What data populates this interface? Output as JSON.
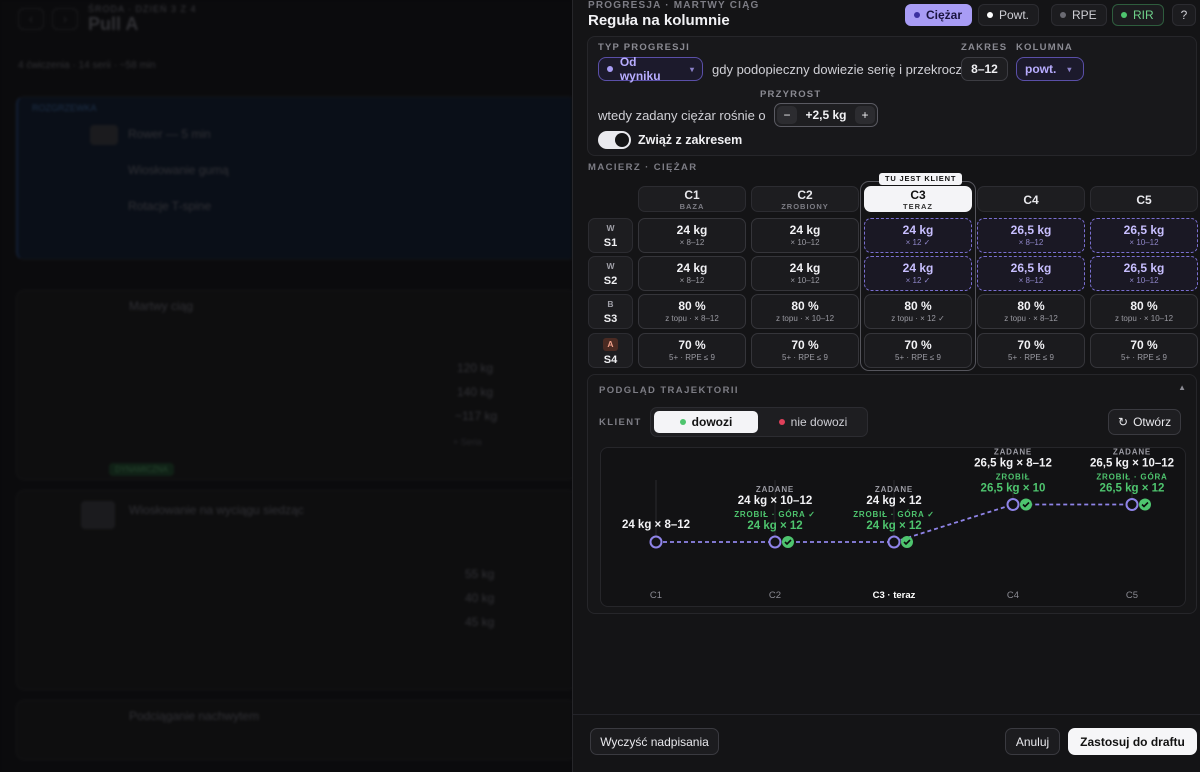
{
  "background": {
    "crumb": "ŚRODA · DZIEŃ 3 Z 4",
    "title": "Pull A",
    "meta": "4 ćwiczenia · 14 serii · ~58 min",
    "warmup_label": "ROZGRZEWKA",
    "warmup_items": [
      "Rower — 5 min",
      "Wiosłowanie gumą",
      "Rotacje T-spine"
    ],
    "exercise1": "Martwy ciąg",
    "exercise1_values": [
      "120 kg",
      "140 kg",
      "~117 kg"
    ],
    "exercise2": "Wiosłowanie na wyciągu siedząc",
    "exercise2_values": [
      "55 kg",
      "40 kg",
      "45 kg"
    ],
    "exercise3": "Podciąganie nachwytem",
    "add_set": "+ Seria",
    "progression_tag": "DYNAMICZNA"
  },
  "header": {
    "eyebrow": "PROGRESJA · MARTWY CIĄG",
    "title": "Reguła na kolumnie",
    "modes": [
      {
        "label": "Ciężar",
        "color": "#3a2fa0"
      },
      {
        "label": "Powt.",
        "color": "#ffffff"
      },
      {
        "label": "RPE",
        "color": "#6a6a72"
      },
      {
        "label": "RIR",
        "color": "#4ec46e"
      }
    ],
    "help": "?"
  },
  "rule": {
    "type_label": "TYP PROGRESJI",
    "type_value": "Od wyniku",
    "condition_text": "gdy podopieczny dowiezie serię i przekroczy",
    "range_label": "ZAKRES",
    "range_value": "8–12",
    "column_label": "KOLUMNA",
    "column_value": "powt.",
    "then_text": "wtedy zadany ciężar rośnie o",
    "increment_label": "PRZYROST",
    "increment_value": "+2,5 kg",
    "minus": "−",
    "plus": "+",
    "toggle_label": "Zwiąż z zakresem",
    "toggle_on": true
  },
  "matrix": {
    "title": "MACIERZ · CIĘŻAR",
    "current_tag": "TU JEST KLIENT",
    "columns": [
      {
        "name": "C1",
        "sub": "BAZA"
      },
      {
        "name": "C2",
        "sub": "ZROBIONY"
      },
      {
        "name": "C3",
        "sub": "TERAZ"
      },
      {
        "name": "C4",
        "sub": ""
      },
      {
        "name": "C5",
        "sub": ""
      }
    ],
    "rows": [
      {
        "tag": "W",
        "name": "S1",
        "cells": [
          {
            "v": "24 kg",
            "s": "× 8–12"
          },
          {
            "v": "24 kg",
            "s": "× 10–12"
          },
          {
            "v": "24 kg",
            "s": "× 12 ✓"
          },
          {
            "v": "26,5 kg",
            "s": "× 8–12"
          },
          {
            "v": "26,5 kg",
            "s": "× 10–12"
          }
        ]
      },
      {
        "tag": "W",
        "name": "S2",
        "cells": [
          {
            "v": "24 kg",
            "s": "× 8–12"
          },
          {
            "v": "24 kg",
            "s": "× 10–12"
          },
          {
            "v": "24 kg",
            "s": "× 12 ✓"
          },
          {
            "v": "26,5 kg",
            "s": "× 8–12"
          },
          {
            "v": "26,5 kg",
            "s": "× 10–12"
          }
        ]
      },
      {
        "tag": "B",
        "name": "S3",
        "cells": [
          {
            "v": "80 %",
            "s": "z topu · × 8–12"
          },
          {
            "v": "80 %",
            "s": "z topu · × 10–12"
          },
          {
            "v": "80 %",
            "s": "z topu · × 12 ✓"
          },
          {
            "v": "80 %",
            "s": "z topu · × 8–12"
          },
          {
            "v": "80 %",
            "s": "z topu · × 10–12"
          }
        ]
      },
      {
        "tag": "A",
        "name": "S4",
        "cells": [
          {
            "v": "70 %",
            "s": "5+ · RPE ≤ 9"
          },
          {
            "v": "70 %",
            "s": "5+ · RPE ≤ 9"
          },
          {
            "v": "70 %",
            "s": "5+ · RPE ≤ 9"
          },
          {
            "v": "70 %",
            "s": "5+ · RPE ≤ 9"
          },
          {
            "v": "70 %",
            "s": "5+ · RPE ≤ 9"
          }
        ]
      }
    ]
  },
  "trajectory": {
    "title": "PODGLĄD TRAJEKTORII",
    "client_label": "KLIENT",
    "opt_yes": "dowozi",
    "opt_no": "nie dowozi",
    "reopen": "Otwórz",
    "points": [
      {
        "x": "C1",
        "label_top": "",
        "planned": "24 kg × 8–12",
        "did_label": "",
        "did": ""
      },
      {
        "x": "C2",
        "label_top": "ZADANE",
        "planned": "24 kg × 10–12",
        "did_label": "ZROBIŁ · GÓRA ✓",
        "did": "24 kg × 12"
      },
      {
        "x": "C3 · teraz",
        "label_top": "ZADANE",
        "planned": "24 kg × 12",
        "did_label": "ZROBIŁ · GÓRA ✓",
        "did": "24 kg × 12"
      },
      {
        "x": "C4",
        "label_top": "ZADANE",
        "planned": "26,5 kg × 8–12",
        "did_label": "ZROBIŁ",
        "did": "26,5 kg × 10"
      },
      {
        "x": "C5",
        "label_top": "ZADANE",
        "planned": "26,5 kg × 10–12",
        "did_label": "ZROBIŁ · GÓRA",
        "did": "26,5 kg × 12"
      }
    ],
    "chart_data": {
      "type": "line",
      "categories": [
        "C1",
        "C2",
        "C3 · teraz",
        "C4",
        "C5"
      ],
      "series": [
        {
          "values": [
            24,
            24,
            24,
            26.5,
            26.5
          ]
        }
      ],
      "completed": [
        false,
        true,
        true,
        true,
        true
      ],
      "colors": {
        "line": "#8f84e8",
        "done": "#4ec46e"
      }
    }
  },
  "footer": {
    "clear": "Wyczyść nadpisania",
    "cancel": "Anuluj",
    "apply": "Zastosuj do draftu"
  }
}
